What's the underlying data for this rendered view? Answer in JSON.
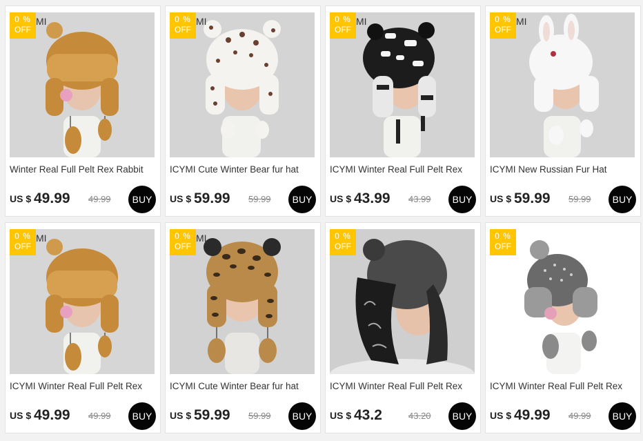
{
  "products": [
    {
      "badge_pct": "0 %",
      "badge_off": "OFF",
      "watermark": "MI",
      "title": "Winter Real Full Pelt Rex Rabbit",
      "currency": "US $",
      "price": "49.99",
      "old_price": "49.99",
      "buy_label": "BUY",
      "image": "tan-trapper-hat"
    },
    {
      "badge_pct": "0 %",
      "badge_off": "OFF",
      "watermark": "MI",
      "title": "ICYMI Cute Winter Bear fur hat",
      "currency": "US $",
      "price": "59.99",
      "old_price": "59.99",
      "buy_label": "BUY",
      "image": "leopard-white-bear-hat"
    },
    {
      "badge_pct": "0 %",
      "badge_off": "OFF",
      "watermark": "MI",
      "title": "ICYMI Winter Real Full Pelt Rex",
      "currency": "US $",
      "price": "43.99",
      "old_price": "43.99",
      "buy_label": "BUY",
      "image": "black-white-bear-hat"
    },
    {
      "badge_pct": "0 %",
      "badge_off": "OFF",
      "watermark": "MI",
      "title": "ICYMI New Russian Fur Hat",
      "currency": "US $",
      "price": "59.99",
      "old_price": "59.99",
      "buy_label": "BUY",
      "image": "white-bunny-hat"
    },
    {
      "badge_pct": "0 %",
      "badge_off": "OFF",
      "watermark": "MI",
      "title": "ICYMI Winter Real Full Pelt Rex",
      "currency": "US $",
      "price": "49.99",
      "old_price": "49.99",
      "buy_label": "BUY",
      "image": "tan-trapper-hat"
    },
    {
      "badge_pct": "0 %",
      "badge_off": "OFF",
      "watermark": "MI",
      "title": "ICYMI Cute Winter Bear fur hat",
      "currency": "US $",
      "price": "59.99",
      "old_price": "59.99",
      "buy_label": "BUY",
      "image": "leopard-brown-bear-hat"
    },
    {
      "badge_pct": "0 %",
      "badge_off": "OFF",
      "watermark": "",
      "title": "ICYMI Winter Real Full Pelt Rex",
      "currency": "US $",
      "price": "43.2",
      "old_price": "43.20",
      "buy_label": "BUY",
      "image": "black-letter-trapper-hat"
    },
    {
      "badge_pct": "0 %",
      "badge_off": "OFF",
      "watermark": "",
      "title": "ICYMI Winter Real Full Pelt Rex",
      "currency": "US $",
      "price": "49.99",
      "old_price": "49.99",
      "buy_label": "BUY",
      "image": "grey-knit-trapper-hat"
    }
  ],
  "colors": {
    "badge_bg": "#ffc600",
    "buy_bg": "#050505",
    "page_bg": "#f2f2f2"
  }
}
